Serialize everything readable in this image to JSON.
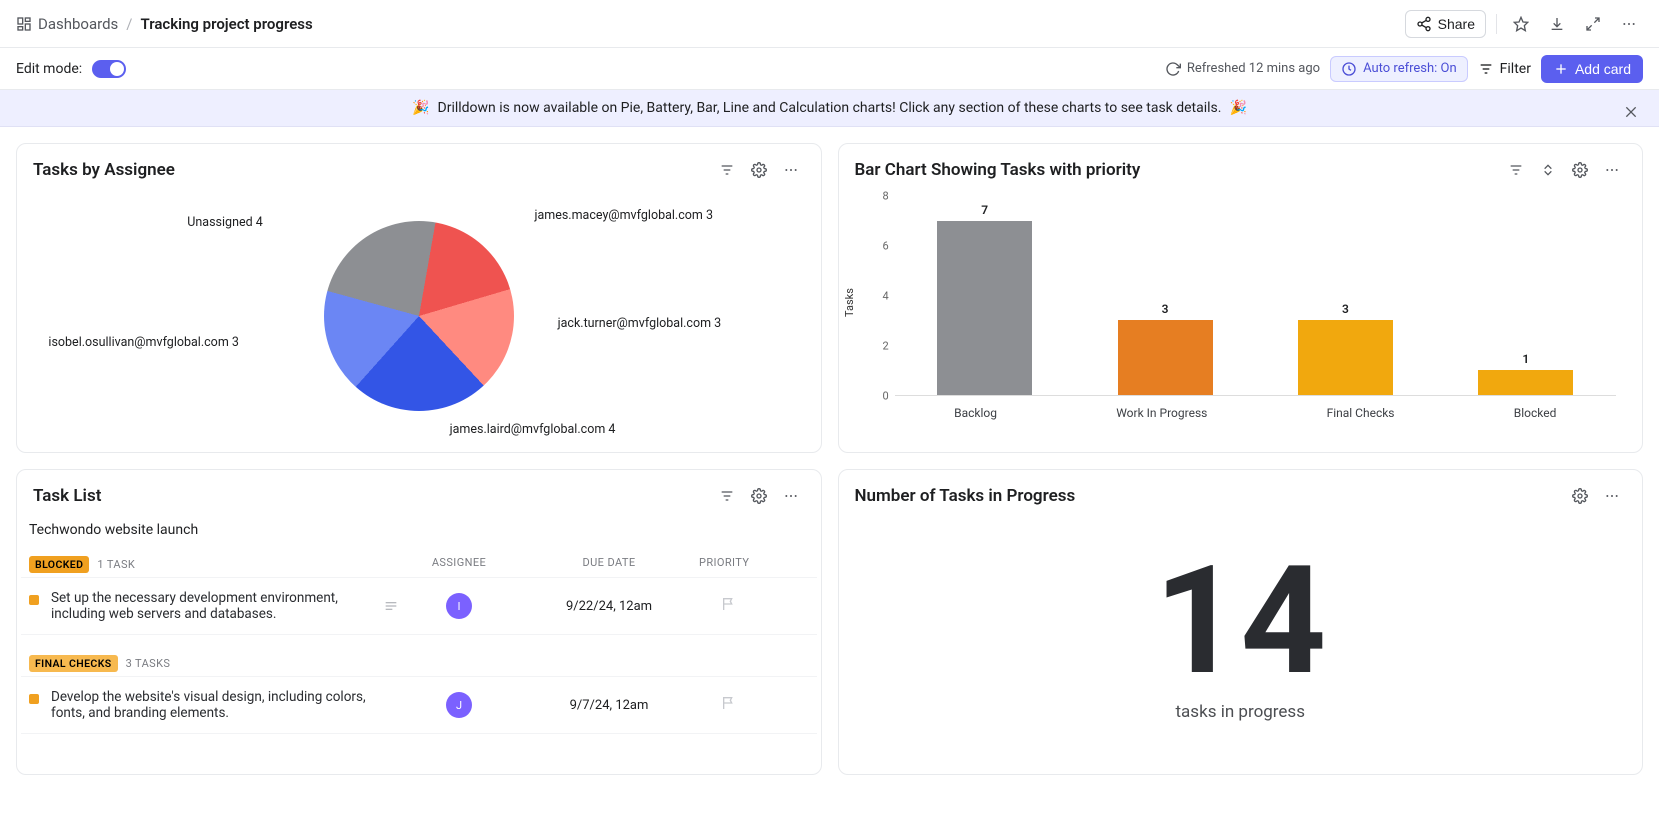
{
  "breadcrumb": {
    "root": "Dashboards",
    "title": "Tracking project progress"
  },
  "topbar": {
    "share": "Share"
  },
  "editbar": {
    "edit_mode": "Edit mode:",
    "refreshed": "Refreshed 12 mins ago",
    "auto_refresh": "Auto refresh: On",
    "filter": "Filter",
    "add_card": "Add card"
  },
  "banner": {
    "text": "Drilldown is now available on Pie, Battery, Bar, Line and Calculation charts! Click any section of these charts to see task details."
  },
  "cards": {
    "pie": {
      "title": "Tasks by Assignee"
    },
    "bar": {
      "title": "Bar Chart Showing Tasks with priority"
    },
    "tasklist": {
      "title": "Task List",
      "project": "Techwondo website launch",
      "cols": {
        "assignee": "ASSIGNEE",
        "due": "DUE DATE",
        "priority": "PRIORITY"
      },
      "groups": {
        "blocked": {
          "label": "BLOCKED",
          "count": "1 TASK"
        },
        "final": {
          "label": "FINAL CHECKS",
          "count": "3 TASKS"
        }
      },
      "rows": {
        "r1": {
          "task": "Set up the necessary development environment, including web servers and databases.",
          "avatar": "I",
          "due": "9/22/24, 12am"
        },
        "r2": {
          "task": "Develop the website's visual design, including colors, fonts, and branding elements.",
          "avatar": "J",
          "due": "9/7/24, 12am"
        }
      }
    },
    "progress": {
      "title": "Number of Tasks in Progress",
      "value": "14",
      "label": "tasks in progress"
    }
  },
  "chart_data": [
    {
      "type": "pie",
      "title": "Tasks by Assignee",
      "series": [
        {
          "name": "james.macey@mvfglobal.com",
          "value": 3,
          "label": "james.macey@mvfglobal.com 3",
          "color": "#ef5350"
        },
        {
          "name": "jack.turner@mvfglobal.com",
          "value": 3,
          "label": "jack.turner@mvfglobal.com 3",
          "color": "#ff8a80"
        },
        {
          "name": "james.laird@mvfglobal.com",
          "value": 4,
          "label": "james.laird@mvfglobal.com 4",
          "color": "#3355e6"
        },
        {
          "name": "isobel.osullivan@mvfglobal.com",
          "value": 3,
          "label": "isobel.osullivan@mvfglobal.com 3",
          "color": "#6b86f4"
        },
        {
          "name": "Unassigned",
          "value": 4,
          "label": "Unassigned 4",
          "color": "#8d8f93"
        }
      ]
    },
    {
      "type": "bar",
      "title": "Bar Chart Showing Tasks with priority",
      "ylabel": "Tasks",
      "ylim": [
        0,
        8
      ],
      "categories": [
        "Backlog",
        "Work In Progress",
        "Final Checks",
        "Blocked"
      ],
      "values": [
        7,
        3,
        3,
        1
      ],
      "colors": [
        "#8d8f93",
        "#e67e22",
        "#f1a80e",
        "#f1a80e"
      ]
    }
  ]
}
